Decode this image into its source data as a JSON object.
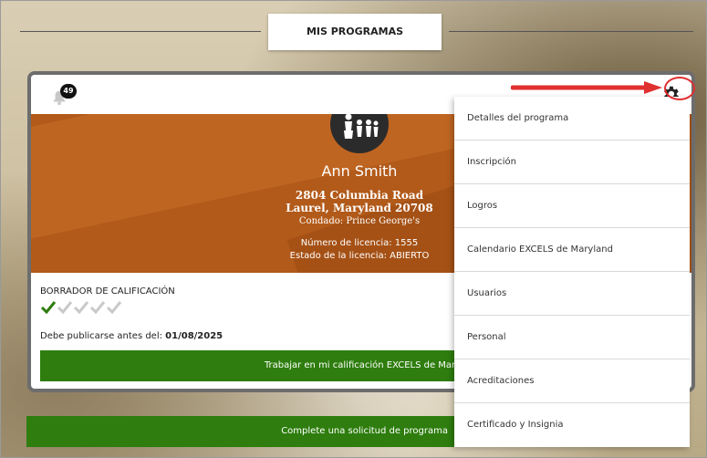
{
  "header": {
    "title": "MIS PROGRAMAS"
  },
  "notifications": {
    "count": "49"
  },
  "program": {
    "name": "Ann Smith",
    "address_line1": "2804 Columbia Road",
    "address_line2": "Laurel, Maryland 20708",
    "county": "Condado: Prince George's",
    "license_number": "Número de licencia: 1555",
    "license_status": "Estado de la licencia: ABIERTO"
  },
  "rating": {
    "label": "BORRADOR DE CALIFICACIÓN",
    "checks_total": 5,
    "checks_done": 1,
    "due_label": "Debe publicarse antes del:",
    "due_date": "01/08/2025",
    "work_button": "Trabajar en mi calificación EXCELS de Maryla"
  },
  "bottom_button": "Complete una solicitud de programa",
  "menu": {
    "items": [
      "Detalles del programa",
      "Inscripción",
      "Logros",
      "Calendario EXCELS de Maryland",
      "Usuarios",
      "Personal",
      "Acreditaciones",
      "Certificado y Insignia"
    ]
  },
  "colors": {
    "accent_green": "#2e7d0e",
    "hero_orange": "#b25a1a",
    "annotation_red": "#e03030"
  }
}
